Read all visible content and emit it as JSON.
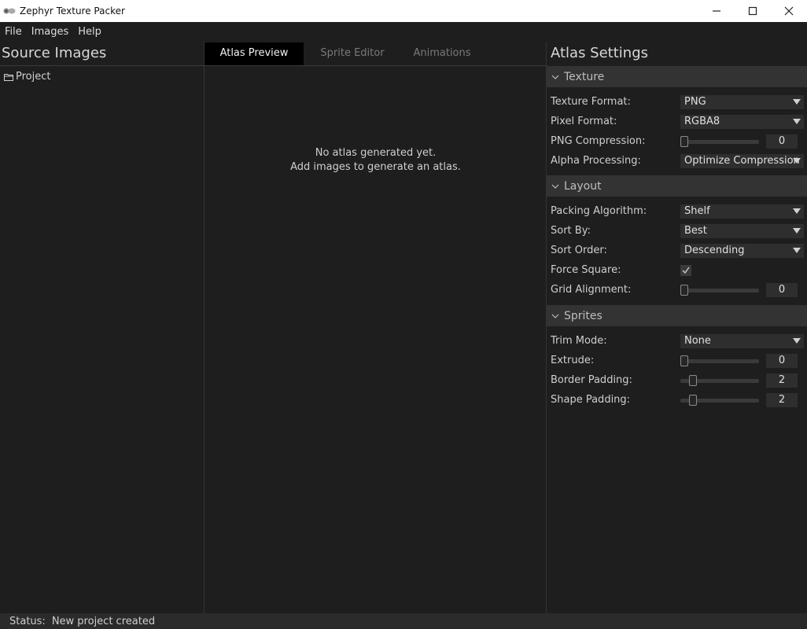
{
  "window": {
    "title": "Zephyr Texture Packer"
  },
  "menu": {
    "items": [
      "File",
      "Images",
      "Help"
    ]
  },
  "left_panel": {
    "title": "Source Images",
    "tree": [
      {
        "label": "Project",
        "icon": "folder-icon"
      }
    ]
  },
  "center": {
    "tabs": [
      {
        "label": "Atlas Preview",
        "active": true
      },
      {
        "label": "Sprite Editor",
        "active": false
      },
      {
        "label": "Animations",
        "active": false
      }
    ],
    "empty_line1": "No atlas generated yet.",
    "empty_line2": "Add images to generate an atlas."
  },
  "right_panel": {
    "title": "Atlas Settings",
    "sections": {
      "texture": {
        "title": "Texture",
        "texture_format": {
          "label": "Texture Format:",
          "value": "PNG"
        },
        "pixel_format": {
          "label": "Pixel Format:",
          "value": "RGBA8"
        },
        "png_compression": {
          "label": "PNG Compression:",
          "value": "0"
        },
        "alpha_processing": {
          "label": "Alpha Processing:",
          "value": "Optimize Compression"
        }
      },
      "layout": {
        "title": "Layout",
        "packing_algorithm": {
          "label": "Packing Algorithm:",
          "value": "Shelf"
        },
        "sort_by": {
          "label": "Sort By:",
          "value": "Best"
        },
        "sort_order": {
          "label": "Sort Order:",
          "value": "Descending"
        },
        "force_square": {
          "label": "Force Square:",
          "checked": true
        },
        "grid_alignment": {
          "label": "Grid Alignment:",
          "value": "0"
        }
      },
      "sprites": {
        "title": "Sprites",
        "trim_mode": {
          "label": "Trim Mode:",
          "value": "None"
        },
        "extrude": {
          "label": "Extrude:",
          "value": "0"
        },
        "border_padding": {
          "label": "Border Padding:",
          "value": "2"
        },
        "shape_padding": {
          "label": "Shape Padding:",
          "value": "2"
        }
      }
    }
  },
  "status": {
    "key": "Status:",
    "text": "New project created"
  }
}
